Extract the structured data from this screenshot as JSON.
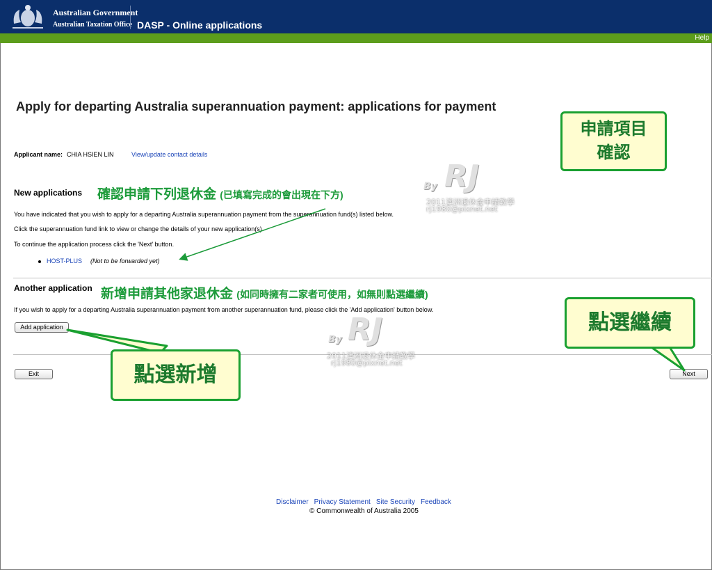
{
  "header": {
    "gov_name": "Australian Government",
    "agency": "Australian Taxation Office",
    "app_title": "DASP - Online applications",
    "help_label": "Help"
  },
  "page": {
    "title": "Apply for departing Australia superannuation payment: applications for payment",
    "applicant_label": "Applicant name:",
    "applicant_name": "CHIA HSIEN LIN",
    "contact_link": "View/update contact details"
  },
  "new_applications": {
    "heading": "New applications",
    "line1": "You have indicated that you wish to apply for a departing Australia superannuation payment from the superannuation fund(s) listed below.",
    "line2": "Click the superannuation fund link to view or change the details of your new application(s).",
    "line3": "To continue the application process click the 'Next' button.",
    "funds": [
      {
        "name": "HOST-PLUS",
        "status": "(Not to be forwarded yet)"
      }
    ]
  },
  "another_application": {
    "heading": "Another application",
    "text": "If you wish to apply for a departing Australia superannuation payment from another superannuation fund, please click the 'Add application' button below.",
    "add_button": "Add application"
  },
  "buttons": {
    "exit": "Exit",
    "next": "Next"
  },
  "footer": {
    "links": [
      "Disclaimer",
      "Privacy Statement",
      "Site Security",
      "Feedback"
    ],
    "copyright": "© Commonwealth of Australia 2005"
  },
  "annotations": {
    "confirm_list_main": "確認申請下列退休金",
    "confirm_list_note": "(已填寫完成的會出現在下方)",
    "add_other_main": "新增申請其他家退休金",
    "add_other_note": "(如同時擁有二家者可使用，如無則點選繼續)",
    "callout_confirm": [
      "申請項目",
      "確認"
    ],
    "callout_next": "點選繼續",
    "callout_add": "點選新增"
  },
  "watermark": {
    "by": "By",
    "brand": "RJ",
    "line1": "2011澳洲退休金申請教學",
    "site": "rj1980@pixnet.net"
  },
  "colors": {
    "header_bg": "#0b2f6b",
    "green_bar": "#5c9d1c",
    "link": "#1a44b8",
    "annotation_green": "#1c9b3a",
    "callout_bg": "#fffdd0"
  }
}
